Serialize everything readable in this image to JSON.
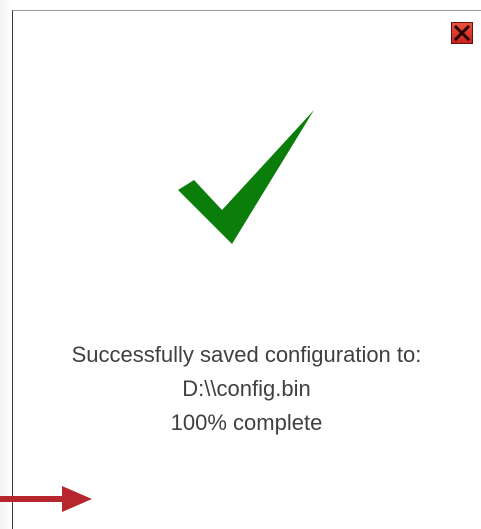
{
  "dialog": {
    "close_icon": "close-icon",
    "success_icon": "checkmark-icon",
    "message_line": "Successfully saved configuration to:",
    "file_path": "D:\\\\config.bin",
    "progress_text": "100% complete",
    "progress": 1.0
  },
  "annotation": {
    "arrow_icon": "arrow-right-icon"
  },
  "colors": {
    "checkmark": "#0b7d0b",
    "close_button": "#d8301f",
    "arrow": "#b8262d",
    "text": "#404040"
  }
}
